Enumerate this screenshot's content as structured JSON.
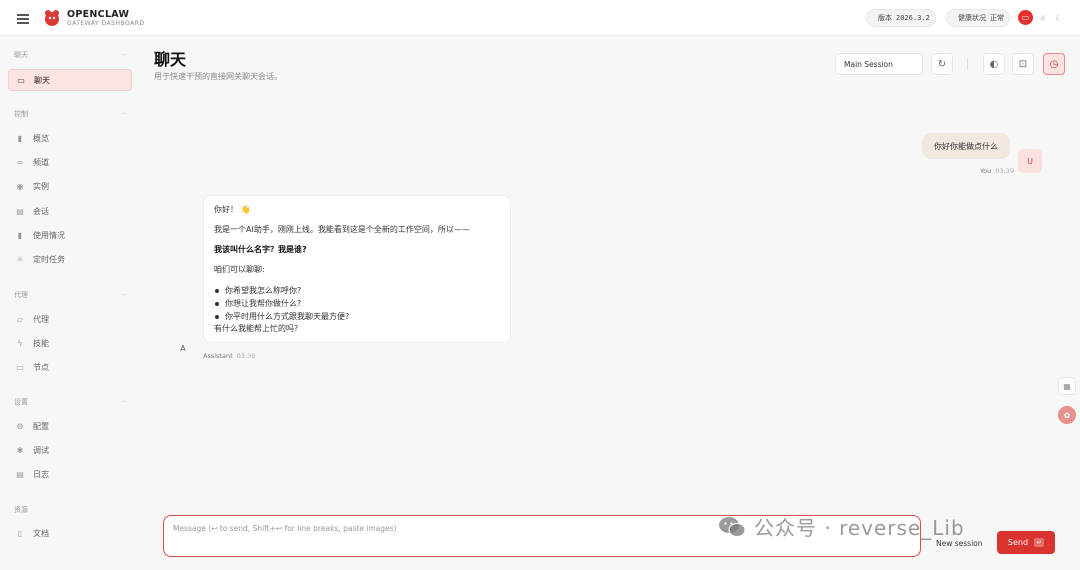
{
  "header": {
    "brand_title": "OPENCLAW",
    "brand_subtitle": "GATEWAY DASHBOARD",
    "version_label": "版本",
    "version_value": "2026.3.2",
    "health_label": "健康状况",
    "health_value": "正常",
    "status_color": "#22b14c",
    "accent_color": "#e5312e"
  },
  "sidebar": {
    "sections": [
      {
        "title": "聊天",
        "items": [
          {
            "label": "聊天",
            "icon": "chat-icon",
            "active": true
          }
        ]
      },
      {
        "title": "控制",
        "items": [
          {
            "label": "概览",
            "icon": "bar-chart-icon"
          },
          {
            "label": "频道",
            "icon": "link-icon"
          },
          {
            "label": "实例",
            "icon": "broadcast-icon"
          },
          {
            "label": "会话",
            "icon": "document-icon"
          },
          {
            "label": "使用情况",
            "icon": "usage-chart-icon"
          },
          {
            "label": "定时任务",
            "icon": "sun-icon"
          }
        ]
      },
      {
        "title": "代理",
        "items": [
          {
            "label": "代理",
            "icon": "folder-icon"
          },
          {
            "label": "技能",
            "icon": "lightning-icon"
          },
          {
            "label": "节点",
            "icon": "monitor-icon"
          }
        ]
      },
      {
        "title": "设置",
        "items": [
          {
            "label": "配置",
            "icon": "gear-icon"
          },
          {
            "label": "调试",
            "icon": "bug-icon"
          },
          {
            "label": "日志",
            "icon": "log-icon"
          }
        ]
      },
      {
        "title": "资源",
        "items": [
          {
            "label": "文档",
            "icon": "book-icon"
          }
        ]
      }
    ]
  },
  "main": {
    "title": "聊天",
    "subtitle": "用于快速干预的直接网关聊天会话。",
    "session_select": "Main Session",
    "toolbar_icons": [
      "refresh-icon",
      "brain-icon",
      "focus-icon",
      "clock-icon"
    ]
  },
  "chat": {
    "user": {
      "avatar": "U",
      "text": "你好你能做点什么",
      "name": "You",
      "time": "03:39"
    },
    "assistant": {
      "avatar": "A",
      "greeting": "你好！ 👋",
      "intro": "我是一个AI助手，刚刚上线。我能看到这是个全新的工作空间，所以——",
      "question": "我该叫什么名字？我是谁?",
      "lead": "咱们可以聊聊:",
      "bullets": [
        "你希望我怎么称呼你?",
        "你想让我帮你做什么?",
        "你平时用什么方式跟我聊天最方便?"
      ],
      "closing": "有什么我能帮上忙的吗?",
      "name": "Assistant",
      "time": "03:39"
    }
  },
  "composer": {
    "placeholder": "Message (↩ to send, Shift+↩ for line breaks, paste images)",
    "new_session_label": "New session",
    "send_label": "Send",
    "send_key": "↵"
  },
  "watermark": {
    "text": "公众号 · reverse_Lib"
  }
}
